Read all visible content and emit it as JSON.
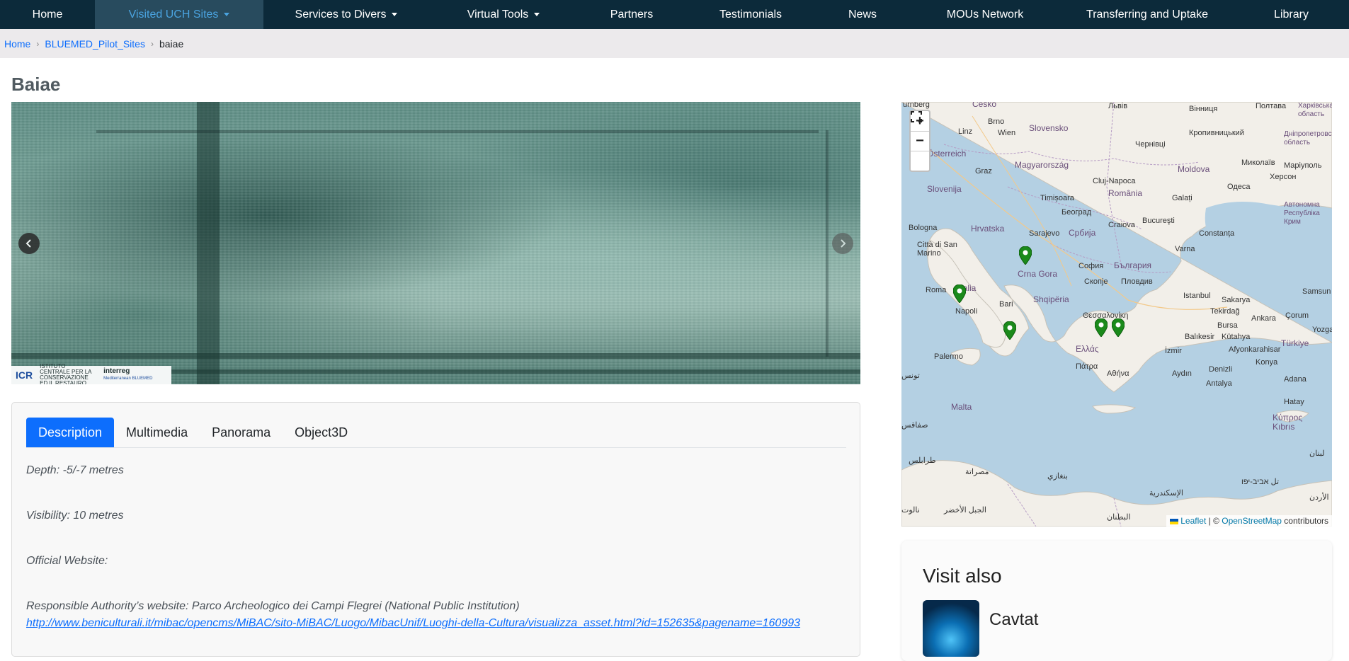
{
  "nav": {
    "items": [
      {
        "label": "Home",
        "dropdown": false
      },
      {
        "label": "Visited UCH Sites",
        "dropdown": true,
        "active": true
      },
      {
        "label": "Services to Divers",
        "dropdown": true
      },
      {
        "label": "Virtual Tools",
        "dropdown": true
      },
      {
        "label": "Partners",
        "dropdown": false
      },
      {
        "label": "Testimonials",
        "dropdown": false
      },
      {
        "label": "News",
        "dropdown": false
      },
      {
        "label": "MOUs Network",
        "dropdown": false
      },
      {
        "label": "Transferring and Uptake",
        "dropdown": false
      },
      {
        "label": "Library",
        "dropdown": false
      }
    ]
  },
  "breadcrumb": {
    "home": "Home",
    "parent": "BLUEMED_Pilot_Sites",
    "current": "baiae"
  },
  "page": {
    "title": "Baiae"
  },
  "carousel": {
    "logo_left": "ICR",
    "logo_left_text": "ISTITUTO CENTRALE PER LA CONSERVAZIONE ED IL RESTAURO",
    "logo_right": "interreg",
    "logo_right_sub": "Mediterranean BLUEMED"
  },
  "tabs": [
    {
      "label": "Description",
      "active": true
    },
    {
      "label": "Multimedia"
    },
    {
      "label": "Panorama"
    },
    {
      "label": "Object3D"
    }
  ],
  "description": {
    "depth": "Depth: -5/-7 metres",
    "visibility": "Visibility: 10 metres",
    "official_website": "Official Website:",
    "authority_label": "Responsible Authority’s website: Parco Archeologico dei Campi Flegrei (National Public Institution)",
    "authority_url": "http://www.beniculturali.it/mibac/opencms/MiBAC/sito-MiBAC/Luogo/MibacUnif/Luoghi-della-Cultura/visualizza_asset.html?id=152635&pagename=160993"
  },
  "map": {
    "zoom_in": "+",
    "zoom_out": "−",
    "fullscreen": "⛶",
    "attribution_leaflet": "Leaflet",
    "attribution_sep": " | © ",
    "attribution_osm": "OpenStreetMap",
    "attribution_contrib": " contributors",
    "pin_color": "#1b8a1b",
    "labels": [
      "urnberg",
      "Česko",
      "Brno",
      "Linz",
      "Wien",
      "Slovensko",
      "Österreich",
      "Magyarország",
      "Graz",
      "Slovenija",
      "Cluj-Napoca",
      "România",
      "Timișoara",
      "Hrvatska",
      "Београд",
      "Bologna",
      "Sarajevo",
      "Србија",
      "Craiova",
      "Bucureşti",
      "Città di San Marino",
      "Crna Gora",
      "София",
      "България",
      "Varna",
      "Roma",
      "Italia",
      "Shqipëria",
      "Скопје",
      "Пловдив",
      "Istanbul",
      "Napoli",
      "Bari",
      "Θεσσαλονίκη",
      "Tekirdağ",
      "Bursa",
      "Ankara",
      "Ελλάς",
      "Palermo",
      "İzmir",
      "Türkiye",
      "Πάτρα",
      "Αθήνα",
      "Malta",
      "Kύπρος Kıbrıs",
      "Львів",
      "Вінниця",
      "Полтава",
      "Чернівці",
      "Кропивницький",
      "Moldova",
      "Миколаїв",
      "Одеса",
      "Херсон",
      "Galați",
      "Constanța",
      "Sakarya",
      "Kütahya",
      "Afyonkarahisar",
      "Balıkesir",
      "Konya",
      "Aydın",
      "Denizli",
      "Antalya",
      "Adana",
      "Hatay",
      "Samsun",
      "Çorum",
      "Yozgat",
      "طرابلس",
      "مصراتة",
      "بنغازي",
      "الجبل الأخضر",
      "تل אביב-יפו",
      "الإسكندرية",
      "البطنان",
      "Маріуполь",
      "Дніпропетровська область",
      "Автономна Республіка Крим",
      "Харківська область",
      "صفاقس",
      "تونس",
      "نالوت",
      "الأردن",
      "لبنان"
    ]
  },
  "visit_also": {
    "title": "Visit also",
    "items": [
      {
        "name": "Cavtat"
      }
    ]
  }
}
